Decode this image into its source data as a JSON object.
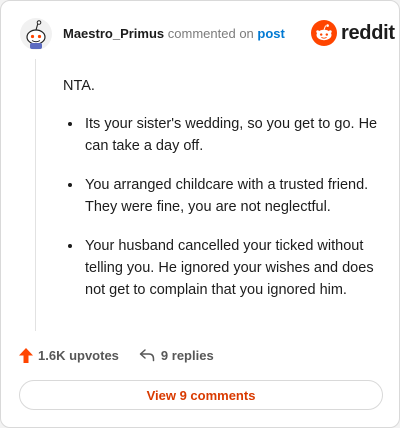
{
  "comment": {
    "username": "Maestro_Primus",
    "action_text": "commented on",
    "target_text": "post"
  },
  "brand": {
    "wordmark": "reddit",
    "icon": "reddit-alien-icon",
    "color": "#ff4500"
  },
  "body": {
    "intro": "NTA.",
    "bullets": [
      "Its your sister's wedding, so you get to go. He can take a day off.",
      "You arranged childcare with a trusted friend. They were fine, you are not neglectful.",
      "Your husband cancelled your ticked without telling you. He ignored your wishes and does not get to complain that you ignored him."
    ]
  },
  "stats": {
    "upvotes": "1.6K upvotes",
    "upvote_icon": "upvote-arrow-icon",
    "replies": "9 replies",
    "reply_icon": "reply-arrow-icon"
  },
  "footer": {
    "button_label": "View 9 comments",
    "accent": "#d93a00"
  }
}
